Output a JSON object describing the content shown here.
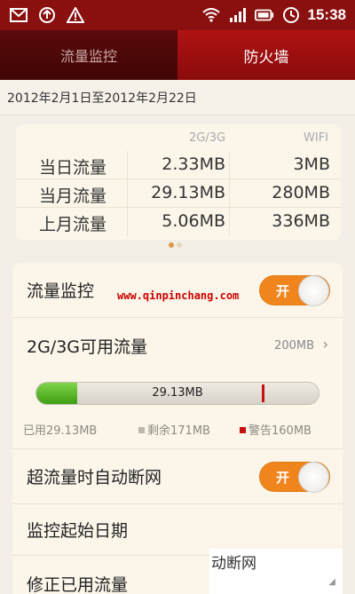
{
  "status_bar": {
    "time": "15:38",
    "icons": [
      "mail-icon",
      "sync-icon",
      "warning-icon",
      "wifi-icon",
      "signal-icon",
      "battery-icon",
      "clock-icon"
    ]
  },
  "tabs": [
    {
      "label": "流量监控",
      "active": false
    },
    {
      "label": "防火墙",
      "active": true
    }
  ],
  "date_range": "2012年2月1日至2012年2月22日",
  "stats": {
    "headers": [
      "2G/3G",
      "WIFI"
    ],
    "rows": [
      {
        "label": "当日流量",
        "mobile": "2.33MB",
        "wifi": "3MB"
      },
      {
        "label": "当月流量",
        "mobile": "29.13MB",
        "wifi": "280MB"
      },
      {
        "label": "上月流量",
        "mobile": "5.06MB",
        "wifi": "336MB"
      }
    ]
  },
  "settings": {
    "monitor": {
      "title": "流量监控",
      "toggle": "开"
    },
    "watermark": "www.qinpinchang.com",
    "available": {
      "title": "2G/3G可用流量",
      "value": "200MB"
    },
    "usage": {
      "label": "29.13MB",
      "used_fraction": 0.1456,
      "warn_fraction": 0.8,
      "used": "已用29.13MB",
      "remaining": "剩余171MB",
      "warning": "警告160MB"
    },
    "auto_cut": {
      "title": "超流量时自动断网",
      "toggle": "开"
    },
    "start_date": {
      "title": "监控起始日期"
    },
    "correct": {
      "title": "修正已用流量"
    }
  },
  "overlay_text": "动断网",
  "colors": {
    "status_bar": "#8a0f0f",
    "tab_active": "#b01313",
    "toggle_on": "#f0851d",
    "bar_fill": "#4caf20",
    "warn": "#c41010"
  }
}
